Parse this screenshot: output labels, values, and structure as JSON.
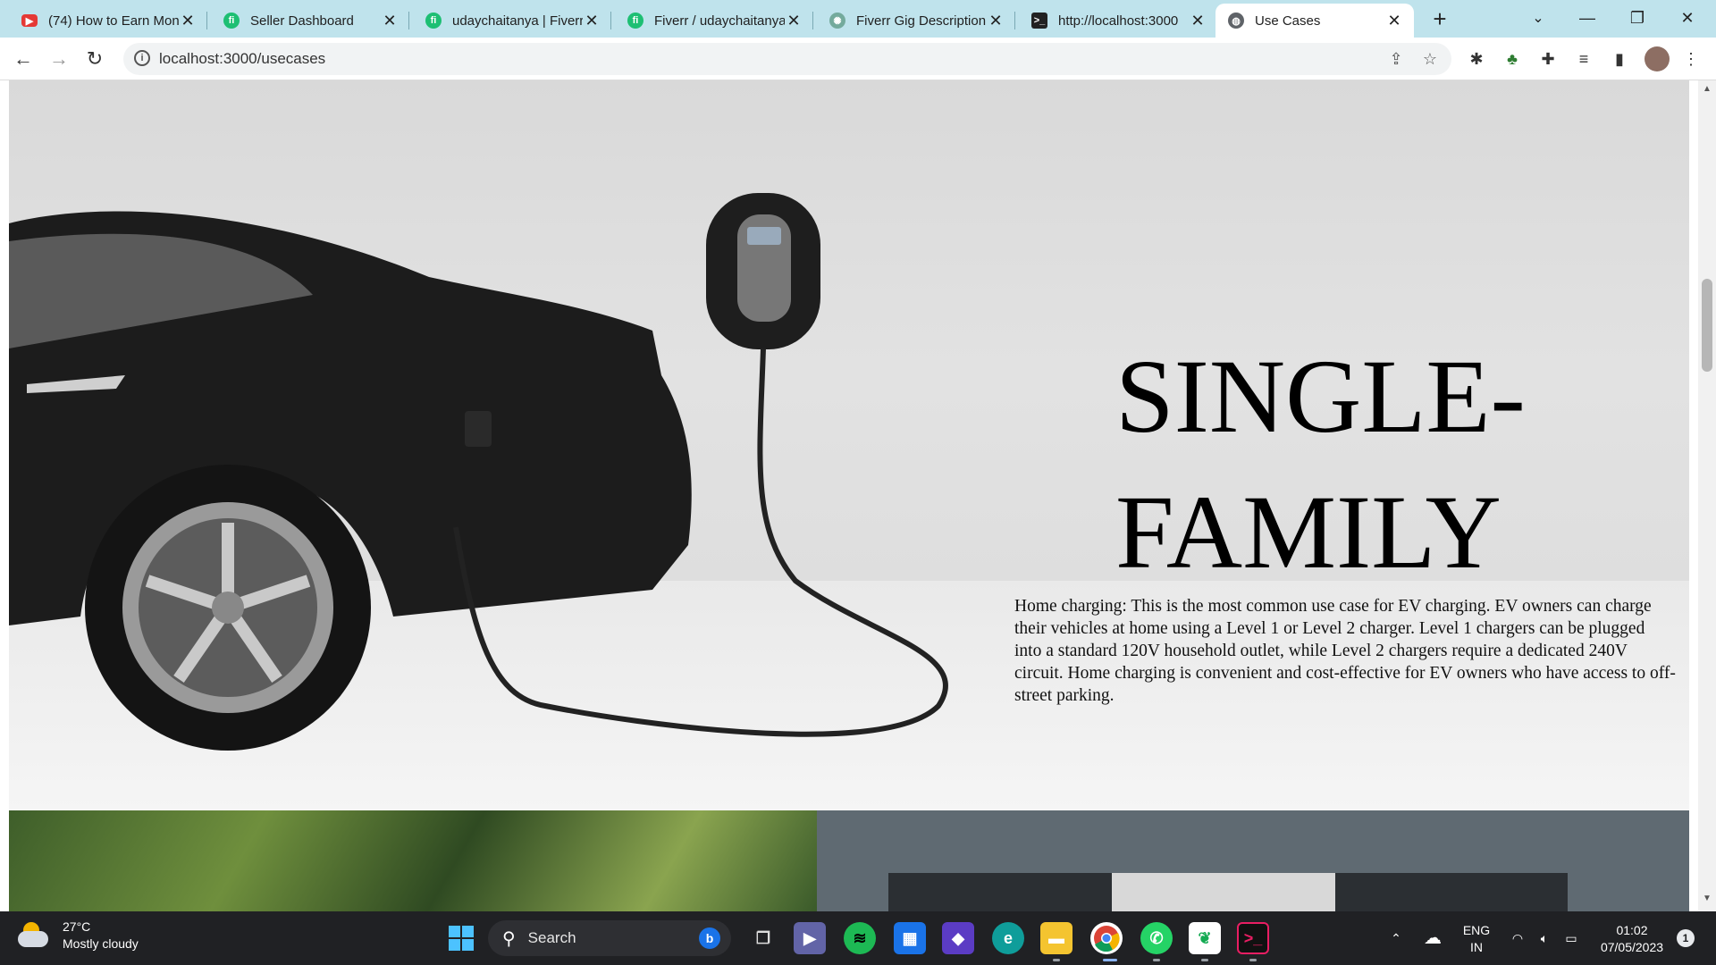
{
  "tabs": [
    {
      "label": "(74) How to Earn Mon",
      "icon": "youtube-icon",
      "color": "#e53935"
    },
    {
      "label": "Seller Dashboard",
      "icon": "fiverr-icon",
      "color": "#1dbf73"
    },
    {
      "label": "udaychaitanya | Fiverr",
      "icon": "fiverr-icon",
      "color": "#1dbf73"
    },
    {
      "label": "Fiverr / udaychaitanya",
      "icon": "fiverr-icon",
      "color": "#1dbf73"
    },
    {
      "label": "Fiverr Gig Description",
      "icon": "chatgpt-icon",
      "color": "#74aa9c"
    },
    {
      "label": "http://localhost:3000",
      "icon": "terminal-icon",
      "color": "#222222"
    },
    {
      "label": "Use Cases",
      "icon": "globe-icon",
      "color": "#5f6368"
    }
  ],
  "toolbar": {
    "url": "localhost:3000/usecases"
  },
  "page": {
    "title_line1": "SINGLE-",
    "title_line2": "FAMILY",
    "description": "Home charging: This is the most common use case for EV charging. EV owners can charge their vehicles at home using a Level 1 or Level 2 charger. Level 1 chargers can be plugged into a standard 120V household outlet, while Level 2 chargers require a dedicated 240V circuit. Home charging is convenient and cost-effective for EV owners who have access to off-street parking."
  },
  "taskbar": {
    "weather_temp": "27°C",
    "weather_desc": "Mostly cloudy",
    "search_label": "Search",
    "lang_line1": "ENG",
    "lang_line2": "IN",
    "time": "01:02",
    "date": "07/05/2023",
    "notification_count": "1"
  },
  "colors": {
    "tabstrip": "#bfe3ec",
    "taskbar": "#202124",
    "accent": "#1a73e8"
  }
}
